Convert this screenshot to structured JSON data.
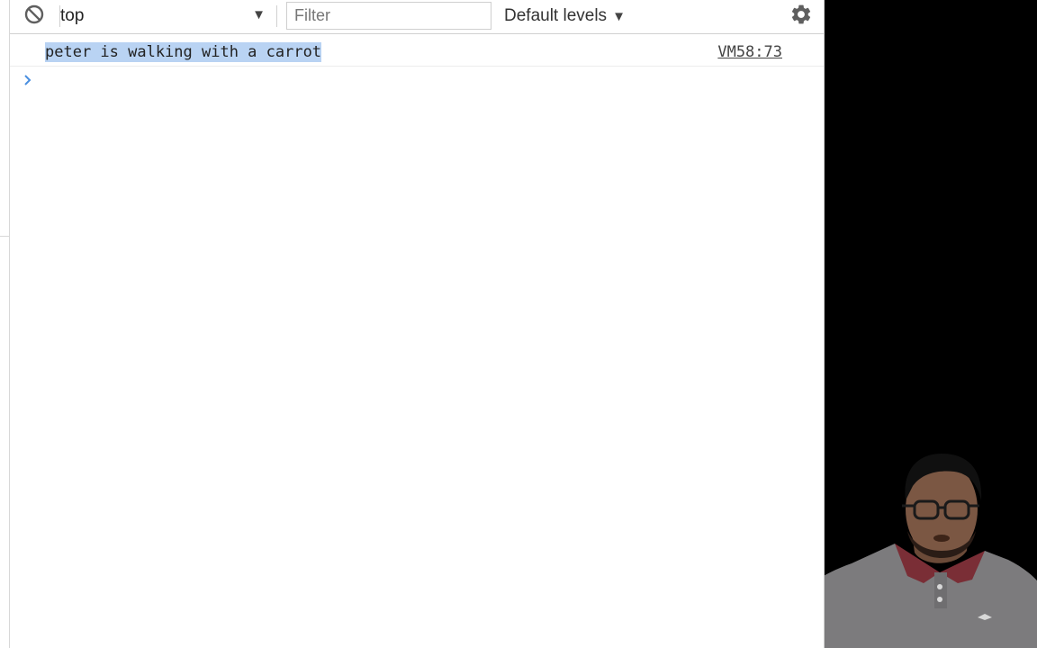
{
  "toolbar": {
    "clear_icon": "block-icon",
    "context": {
      "label": "top",
      "arrow_icon": "triangle-down-icon"
    },
    "filter": {
      "placeholder": "Filter",
      "value": ""
    },
    "levels": {
      "label": "Default levels",
      "arrow_icon": "triangle-down-icon"
    },
    "settings_icon": "gear-icon"
  },
  "console": {
    "messages": [
      {
        "text": "peter is walking with a carrot",
        "source": "VM58:73",
        "selected": true
      }
    ],
    "prompt_icon": "chevron-right-icon"
  },
  "colors": {
    "selection": "#b9d3f3",
    "prompt_accent": "#4a8fe0",
    "background": "#ffffff",
    "webcam_background": "#000000"
  }
}
